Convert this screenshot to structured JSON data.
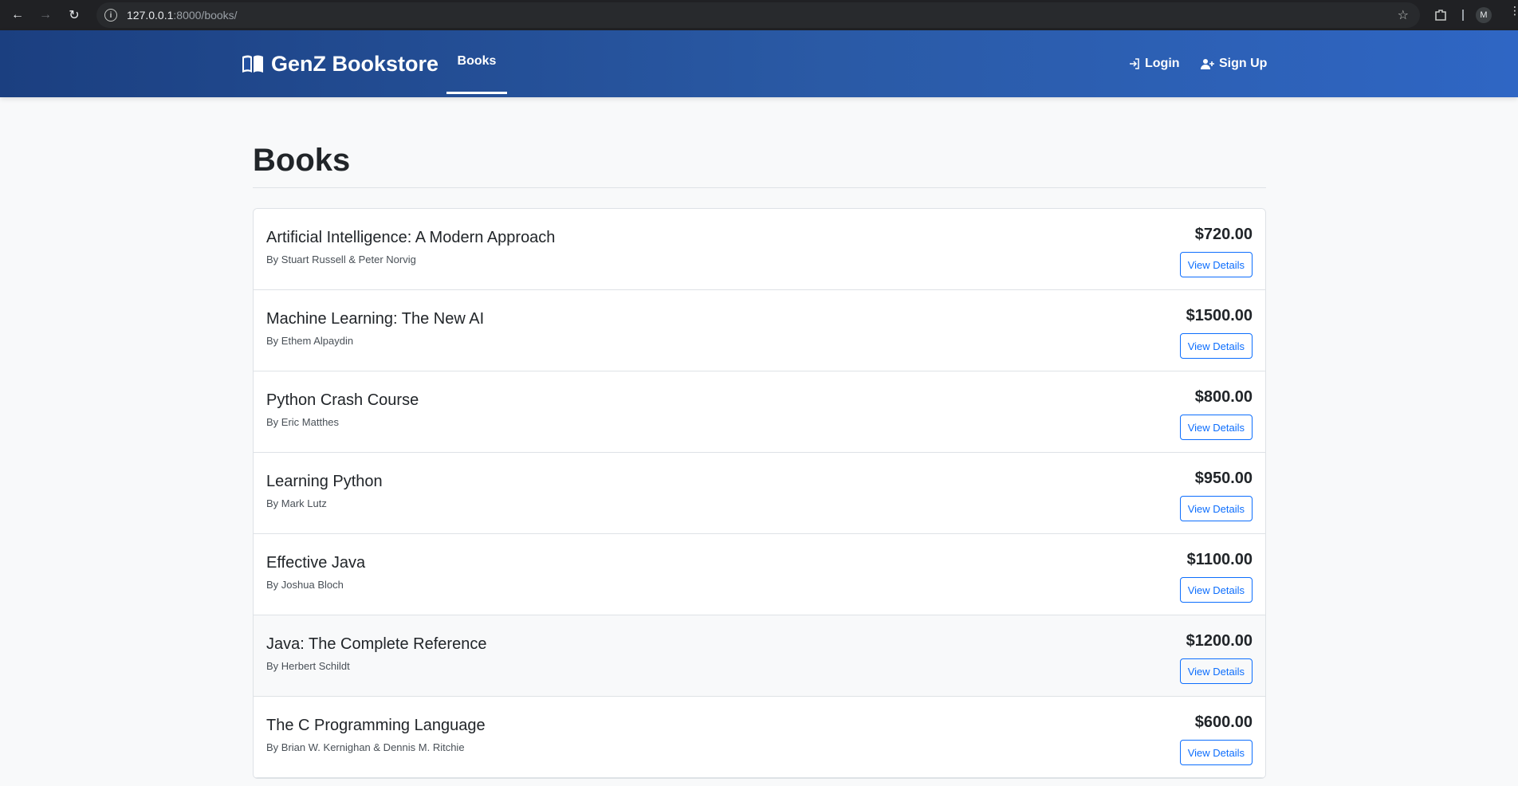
{
  "browser": {
    "url_host": "127.0.0.1",
    "url_path": ":8000/books/",
    "profile_initial": "M"
  },
  "navbar": {
    "brand": "GenZ Bookstore",
    "books": "Books",
    "login": "Login",
    "signup": "Sign Up"
  },
  "page": {
    "title": "Books",
    "view_label": "View Details"
  },
  "books": [
    {
      "title": "Artificial Intelligence: A Modern Approach",
      "author": "By Stuart Russell & Peter Norvig",
      "price": "$720.00"
    },
    {
      "title": "Machine Learning: The New AI",
      "author": "By Ethem Alpaydin",
      "price": "$1500.00"
    },
    {
      "title": "Python Crash Course",
      "author": "By Eric Matthes",
      "price": "$800.00"
    },
    {
      "title": "Learning Python",
      "author": "By Mark Lutz",
      "price": "$950.00"
    },
    {
      "title": "Effective Java",
      "author": "By Joshua Bloch",
      "price": "$1100.00"
    },
    {
      "title": "Java: The Complete Reference",
      "author": "By Herbert Schildt",
      "price": "$1200.00"
    },
    {
      "title": "The C Programming Language",
      "author": "By Brian W. Kernighan & Dennis M. Ritchie",
      "price": "$600.00"
    }
  ]
}
